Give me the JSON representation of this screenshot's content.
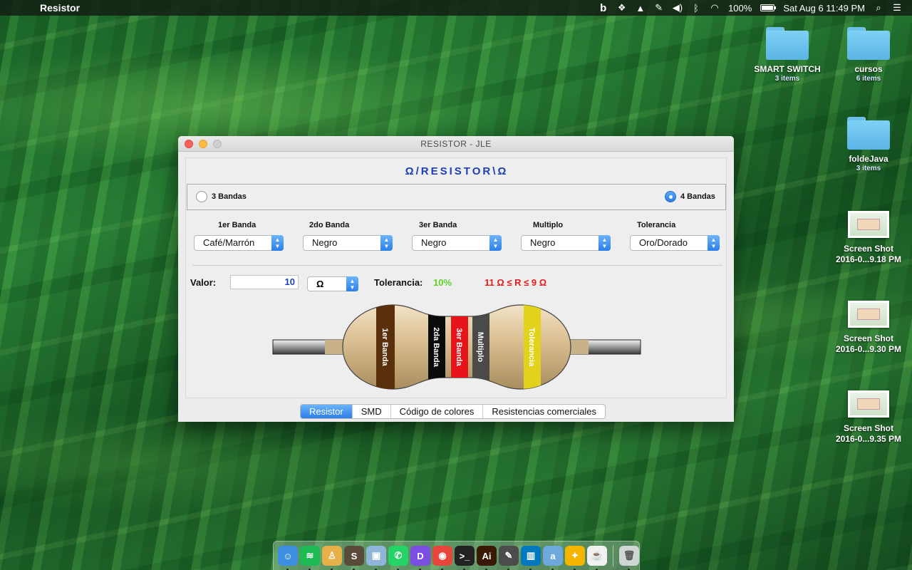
{
  "menubar": {
    "app_name": "Resistor",
    "battery": "100%",
    "clock": "Sat Aug 6  11:49 PM"
  },
  "desktop": {
    "icons": [
      {
        "name": "SMART SWITCH",
        "sub": "3 items",
        "kind": "folder"
      },
      {
        "name": "cursos",
        "sub": "6 items",
        "kind": "folder"
      },
      {
        "name": "foldeJava",
        "sub": "3 items",
        "kind": "folder"
      },
      {
        "name": "Screen Shot",
        "sub": "2016-0...9.18 PM",
        "kind": "screenshot"
      },
      {
        "name": "Screen Shot",
        "sub": "2016-0...9.30 PM",
        "kind": "screenshot"
      },
      {
        "name": "Screen Shot",
        "sub": "2016-0...9.35 PM",
        "kind": "screenshot"
      }
    ]
  },
  "window": {
    "title": "RESISTOR - JLE",
    "header": "Ω/RESISTOR\\Ω",
    "band_options": [
      {
        "label": "3 Bandas",
        "selected": false
      },
      {
        "label": "4 Bandas",
        "selected": true
      }
    ],
    "columns": [
      {
        "label": "1er Banda",
        "value": "Café/Marrón"
      },
      {
        "label": "2do Banda",
        "value": "Negro"
      },
      {
        "label": "3er Banda",
        "value": "Negro"
      },
      {
        "label": "Multiplo",
        "value": "Negro"
      },
      {
        "label": "Tolerancia",
        "value": "Oro/Dorado"
      }
    ],
    "valor": {
      "label": "Valor:",
      "value": "10",
      "unit": "Ω"
    },
    "tolerancia": {
      "label": "Tolerancia:",
      "value": "10%"
    },
    "range_text": "11 Ω ≤ R ≤ 9 Ω",
    "resistor": {
      "bands": [
        {
          "label": "1er Banda",
          "color": "#5a2f0c"
        },
        {
          "label": "2da Banda",
          "color": "#0b0b0b"
        },
        {
          "label": "3er Banda",
          "color": "#e8141b"
        },
        {
          "label": "Multiplo",
          "color": "#4a4a4a"
        },
        {
          "label": "Tolerancia",
          "color": "#e3d21c"
        }
      ],
      "body_color": "#dcc194"
    },
    "tabs": [
      {
        "label": "Resistor",
        "active": true
      },
      {
        "label": "SMD",
        "active": false
      },
      {
        "label": "Código de colores",
        "active": false
      },
      {
        "label": "Resistencias comerciales",
        "active": false
      }
    ]
  },
  "dock": {
    "apps": [
      {
        "name": "Finder",
        "color": "#3c8fe0",
        "glyph": "☺"
      },
      {
        "name": "Spotify",
        "color": "#1db954",
        "glyph": "≋"
      },
      {
        "name": "Preview",
        "color": "#e6b04a",
        "glyph": "♙"
      },
      {
        "name": "Sublime Text",
        "color": "#5a4a3a",
        "glyph": "S"
      },
      {
        "name": "VirtualBox",
        "color": "#8fb6d9",
        "glyph": "▣"
      },
      {
        "name": "WhatsApp",
        "color": "#25d366",
        "glyph": "✆"
      },
      {
        "name": "Deezer",
        "color": "#7b4de0",
        "glyph": "D"
      },
      {
        "name": "Chrome",
        "color": "#e8453c",
        "glyph": "◉"
      },
      {
        "name": "Terminal",
        "color": "#222222",
        "glyph": ">_"
      },
      {
        "name": "Illustrator",
        "color": "#3a1a06",
        "glyph": "Ai"
      },
      {
        "name": "Evernote",
        "color": "#4c4c4c",
        "glyph": "✎"
      },
      {
        "name": "Trello",
        "color": "#0079bf",
        "glyph": "▥"
      },
      {
        "name": "Amazon",
        "color": "#6fa8dc",
        "glyph": "a"
      },
      {
        "name": "Idea",
        "color": "#f4b400",
        "glyph": "✦"
      },
      {
        "name": "Java",
        "color": "#f1f1f1",
        "glyph": "☕"
      },
      {
        "name": "Trash",
        "color": "#cfd6d6",
        "glyph": "🗑"
      }
    ]
  }
}
